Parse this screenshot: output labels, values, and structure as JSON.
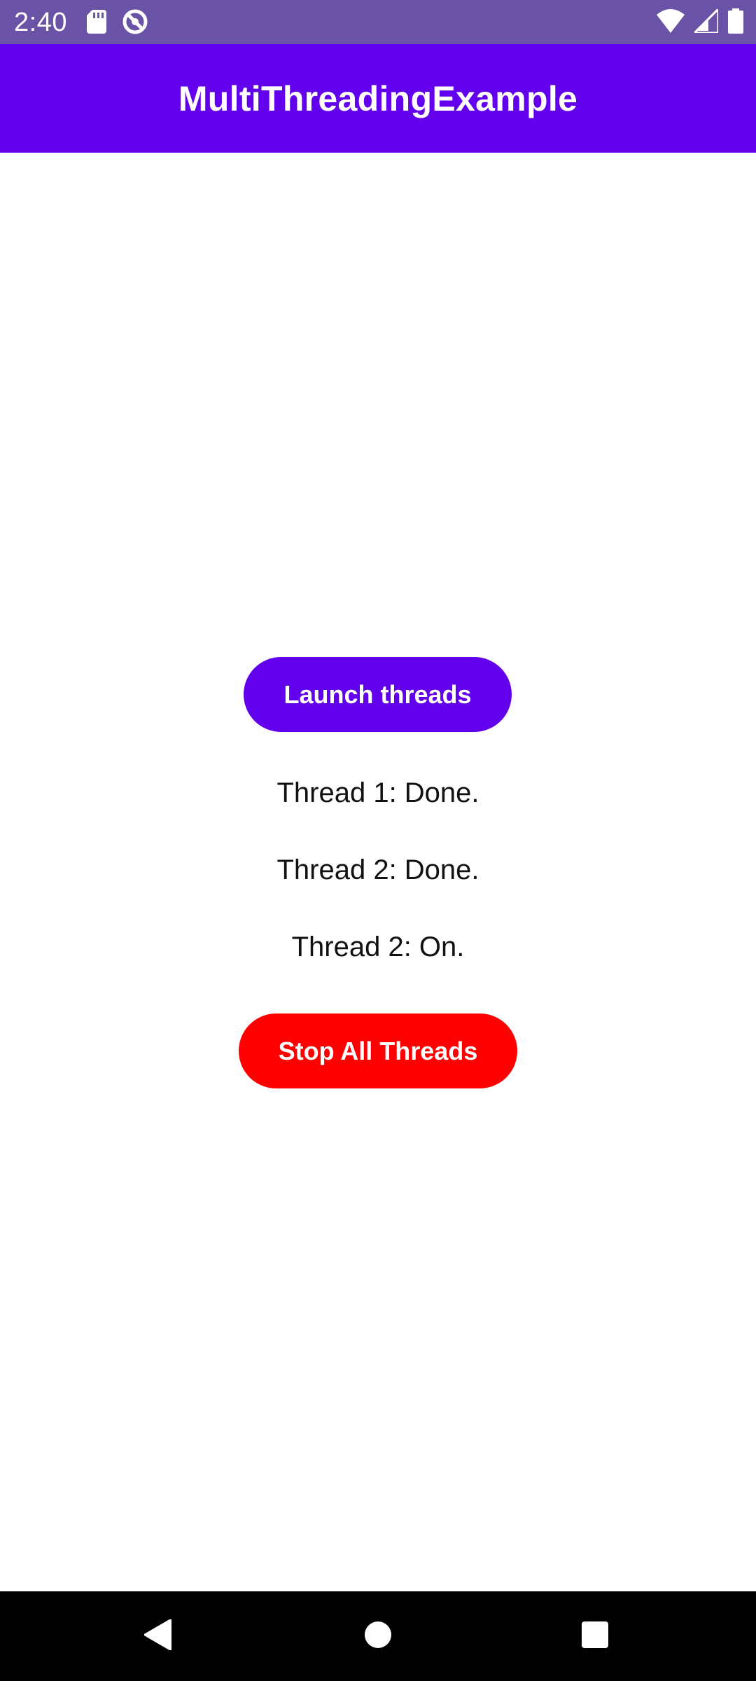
{
  "status_bar": {
    "time": "2:40",
    "left_icons": [
      "sd-card-icon",
      "do-not-disturb-icon"
    ],
    "right_icons": [
      "wifi-icon",
      "cellular-signal-icon",
      "battery-icon"
    ],
    "background": "#6a53a6"
  },
  "app_bar": {
    "title": "MultiThreadingExample",
    "background": "#6200ee"
  },
  "main": {
    "launch_button_label": "Launch threads",
    "thread_status": [
      "Thread 1: Done.",
      "Thread 2: Done.",
      "Thread 2: On."
    ],
    "stop_button_label": "Stop All Threads",
    "launch_button_color": "#6200ee",
    "stop_button_color": "#ff0000"
  },
  "nav_bar": {
    "icons": [
      "back-icon",
      "home-icon",
      "recents-icon"
    ]
  }
}
